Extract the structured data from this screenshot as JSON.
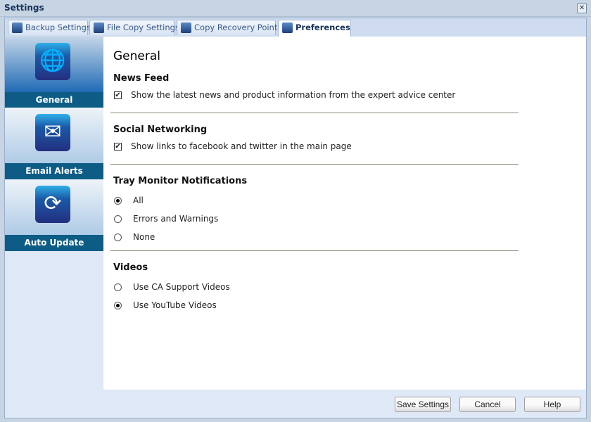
{
  "window": {
    "title": "Settings",
    "close": "✕"
  },
  "tabs": [
    {
      "label": "Backup Settings"
    },
    {
      "label": "File Copy Settings"
    },
    {
      "label": "Copy Recovery Points"
    },
    {
      "label": "Preferences"
    }
  ],
  "sidebar": [
    {
      "label": "General",
      "icon": "globe-icon",
      "glyph": "🌐"
    },
    {
      "label": "Email Alerts",
      "icon": "email-alert-icon",
      "glyph": "✉"
    },
    {
      "label": "Auto Update",
      "icon": "update-icon",
      "glyph": "⟳"
    }
  ],
  "main": {
    "title": "General",
    "news": {
      "heading": "News Feed",
      "checkbox": "Show the latest news and product information from the expert advice center",
      "checked": true
    },
    "social": {
      "heading": "Social Networking",
      "checkbox": "Show links to facebook and twitter in the main page",
      "checked": true
    },
    "tray": {
      "heading": "Tray Monitor Notifications",
      "options": [
        "All",
        "Errors and Warnings",
        "None"
      ],
      "selected": "All"
    },
    "videos": {
      "heading": "Videos",
      "options": [
        "Use CA Support Videos",
        "Use YouTube Videos"
      ],
      "selected": "Use YouTube Videos"
    }
  },
  "footer": {
    "save": "Save Settings",
    "cancel": "Cancel",
    "help": "Help"
  }
}
